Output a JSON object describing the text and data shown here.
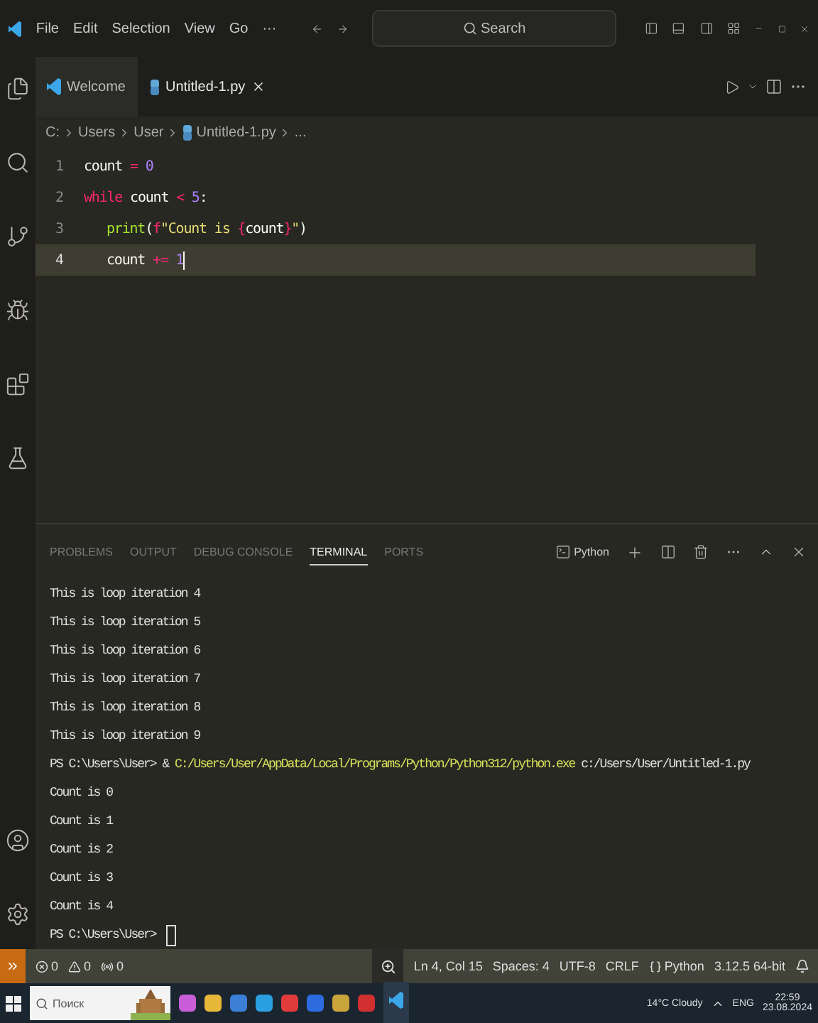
{
  "title_bar": {
    "menu": [
      "File",
      "Edit",
      "Selection",
      "View",
      "Go",
      "···"
    ],
    "search": {
      "placeholder": "Search"
    }
  },
  "tabs": [
    {
      "label": "Welcome",
      "kind": "welcome",
      "selected": false
    },
    {
      "label": "Untitled-1.py",
      "kind": "python",
      "selected": true
    }
  ],
  "breadcrumbs": [
    "C:",
    "Users",
    "User",
    "Untitled-1.py",
    "..."
  ],
  "editor": {
    "lines": [
      {
        "number": "1",
        "current": false,
        "tokens": [
          {
            "text": "count",
            "kind": "name"
          },
          {
            "text": " = ",
            "kind": "op"
          },
          {
            "text": "0",
            "kind": "number"
          }
        ]
      },
      {
        "number": "2",
        "current": false,
        "tokens": [
          {
            "text": "while",
            "kind": "keyword"
          },
          {
            "text": " count ",
            "kind": "name"
          },
          {
            "text": "<",
            "kind": "op"
          },
          {
            "text": " 5",
            "kind": "number"
          },
          {
            "text": ":",
            "kind": "name"
          }
        ],
        "children": [
          {
            "number": "3",
            "current": false,
            "tokens": [
              {
                "text": "print",
                "kind": "func"
              },
              {
                "text": "(",
                "kind": "name"
              },
              {
                "text": "f",
                "kind": "keyword"
              },
              {
                "text": "\"Count is ",
                "kind": "string"
              },
              {
                "text": "{",
                "kind": "keyword"
              },
              {
                "text": "count",
                "kind": "name"
              },
              {
                "text": "}",
                "kind": "keyword"
              },
              {
                "text": "\"",
                "kind": "string"
              },
              {
                "text": ")",
                "kind": "name"
              }
            ]
          },
          {
            "number": "4",
            "current": true,
            "tokens": [
              {
                "text": "count",
                "kind": "name"
              },
              {
                "text": " += ",
                "kind": "op"
              },
              {
                "text": "1",
                "kind": "number"
              }
            ]
          }
        ]
      }
    ]
  },
  "panel": {
    "tabs": [
      {
        "label": "PROBLEMS",
        "selected": false
      },
      {
        "label": "OUTPUT",
        "selected": false
      },
      {
        "label": "DEBUG CONSOLE",
        "selected": false
      },
      {
        "label": "TERMINAL",
        "selected": true
      },
      {
        "label": "PORTS",
        "selected": false
      }
    ],
    "terminal_name": "Python",
    "lines": [
      {
        "kind": "output",
        "text": "This is loop iteration 4"
      },
      {
        "kind": "output",
        "text": "This is loop iteration 5"
      },
      {
        "kind": "output",
        "text": "This is loop iteration 6"
      },
      {
        "kind": "output",
        "text": "This is loop iteration 7"
      },
      {
        "kind": "output",
        "text": "This is loop iteration 8"
      },
      {
        "kind": "output",
        "text": "This is loop iteration 9"
      },
      {
        "kind": "command",
        "prompt": "PS C:\\Users\\User> &",
        "program": "C:/Users/User/AppData/Local/Programs/Python/Python312/python.exe",
        "argument": "c:/Users/User/Untitled-1.py"
      },
      {
        "kind": "output",
        "text": "Count is 0"
      },
      {
        "kind": "output",
        "text": "Count is 1"
      },
      {
        "kind": "output",
        "text": "Count is 2"
      },
      {
        "kind": "output",
        "text": "Count is 3"
      },
      {
        "kind": "output",
        "text": "Count is 4"
      },
      {
        "kind": "prompt",
        "prompt": "PS C:\\Users\\User>"
      }
    ]
  },
  "status_bar": {
    "errors": "0",
    "warnings": "0",
    "ports": "0",
    "items": [
      "Ln 4, Col 15",
      "Spaces: 4",
      "UTF-8",
      "CRLF"
    ],
    "language": "Python",
    "interpreter": "3.12.5 64-bit"
  },
  "taskbar": {
    "search": {
      "placeholder": "Поиск"
    },
    "weather": "14°C Cloudy",
    "language": "ENG",
    "time": "22:59",
    "date": "23.08.2024"
  }
}
